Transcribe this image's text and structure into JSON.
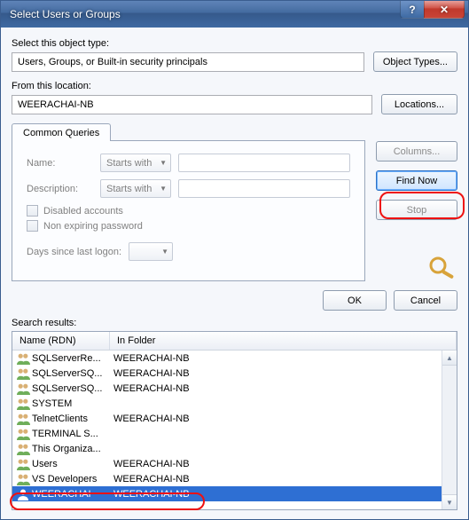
{
  "titlebar": {
    "title": "Select Users or Groups",
    "help": "?",
    "close": "✕"
  },
  "objectType": {
    "label": "Select this object type:",
    "value": "Users, Groups, or Built-in security principals",
    "button": "Object Types..."
  },
  "location": {
    "label": "From this location:",
    "value": "WEERACHAI-NB",
    "button": "Locations..."
  },
  "tabs": {
    "commonQueries": "Common Queries"
  },
  "query": {
    "nameLabel": "Name:",
    "descLabel": "Description:",
    "starts": "Starts with",
    "disabled": "Disabled accounts",
    "nonexp": "Non expiring password",
    "daysLabel": "Days since last logon:"
  },
  "side": {
    "columns": "Columns...",
    "findNow": "Find Now",
    "stop": "Stop"
  },
  "okrow": {
    "ok": "OK",
    "cancel": "Cancel"
  },
  "results": {
    "label": "Search results:",
    "colName": "Name (RDN)",
    "colFolder": "In Folder",
    "rows": [
      {
        "name": "SQLServerRe...",
        "folder": "WEERACHAI-NB",
        "icon": "group"
      },
      {
        "name": "SQLServerSQ...",
        "folder": "WEERACHAI-NB",
        "icon": "group"
      },
      {
        "name": "SQLServerSQ...",
        "folder": "WEERACHAI-NB",
        "icon": "group"
      },
      {
        "name": "SYSTEM",
        "folder": "",
        "icon": "group"
      },
      {
        "name": "TelnetClients",
        "folder": "WEERACHAI-NB",
        "icon": "group"
      },
      {
        "name": "TERMINAL S...",
        "folder": "",
        "icon": "group"
      },
      {
        "name": "This Organiza...",
        "folder": "",
        "icon": "group"
      },
      {
        "name": "Users",
        "folder": "WEERACHAI-NB",
        "icon": "group"
      },
      {
        "name": "VS Developers",
        "folder": "WEERACHAI-NB",
        "icon": "group"
      },
      {
        "name": "WEERACHAI",
        "folder": "WEERACHAI-NB",
        "icon": "user",
        "selected": true
      }
    ]
  }
}
